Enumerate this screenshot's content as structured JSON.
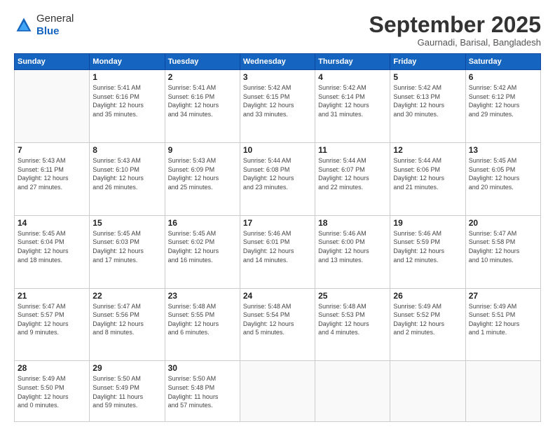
{
  "logo": {
    "general": "General",
    "blue": "Blue"
  },
  "header": {
    "month": "September 2025",
    "location": "Gaurnadi, Barisal, Bangladesh"
  },
  "weekdays": [
    "Sunday",
    "Monday",
    "Tuesday",
    "Wednesday",
    "Thursday",
    "Friday",
    "Saturday"
  ],
  "weeks": [
    [
      {
        "day": "",
        "info": ""
      },
      {
        "day": "1",
        "info": "Sunrise: 5:41 AM\nSunset: 6:16 PM\nDaylight: 12 hours\nand 35 minutes."
      },
      {
        "day": "2",
        "info": "Sunrise: 5:41 AM\nSunset: 6:16 PM\nDaylight: 12 hours\nand 34 minutes."
      },
      {
        "day": "3",
        "info": "Sunrise: 5:42 AM\nSunset: 6:15 PM\nDaylight: 12 hours\nand 33 minutes."
      },
      {
        "day": "4",
        "info": "Sunrise: 5:42 AM\nSunset: 6:14 PM\nDaylight: 12 hours\nand 31 minutes."
      },
      {
        "day": "5",
        "info": "Sunrise: 5:42 AM\nSunset: 6:13 PM\nDaylight: 12 hours\nand 30 minutes."
      },
      {
        "day": "6",
        "info": "Sunrise: 5:42 AM\nSunset: 6:12 PM\nDaylight: 12 hours\nand 29 minutes."
      }
    ],
    [
      {
        "day": "7",
        "info": "Sunrise: 5:43 AM\nSunset: 6:11 PM\nDaylight: 12 hours\nand 27 minutes."
      },
      {
        "day": "8",
        "info": "Sunrise: 5:43 AM\nSunset: 6:10 PM\nDaylight: 12 hours\nand 26 minutes."
      },
      {
        "day": "9",
        "info": "Sunrise: 5:43 AM\nSunset: 6:09 PM\nDaylight: 12 hours\nand 25 minutes."
      },
      {
        "day": "10",
        "info": "Sunrise: 5:44 AM\nSunset: 6:08 PM\nDaylight: 12 hours\nand 23 minutes."
      },
      {
        "day": "11",
        "info": "Sunrise: 5:44 AM\nSunset: 6:07 PM\nDaylight: 12 hours\nand 22 minutes."
      },
      {
        "day": "12",
        "info": "Sunrise: 5:44 AM\nSunset: 6:06 PM\nDaylight: 12 hours\nand 21 minutes."
      },
      {
        "day": "13",
        "info": "Sunrise: 5:45 AM\nSunset: 6:05 PM\nDaylight: 12 hours\nand 20 minutes."
      }
    ],
    [
      {
        "day": "14",
        "info": "Sunrise: 5:45 AM\nSunset: 6:04 PM\nDaylight: 12 hours\nand 18 minutes."
      },
      {
        "day": "15",
        "info": "Sunrise: 5:45 AM\nSunset: 6:03 PM\nDaylight: 12 hours\nand 17 minutes."
      },
      {
        "day": "16",
        "info": "Sunrise: 5:45 AM\nSunset: 6:02 PM\nDaylight: 12 hours\nand 16 minutes."
      },
      {
        "day": "17",
        "info": "Sunrise: 5:46 AM\nSunset: 6:01 PM\nDaylight: 12 hours\nand 14 minutes."
      },
      {
        "day": "18",
        "info": "Sunrise: 5:46 AM\nSunset: 6:00 PM\nDaylight: 12 hours\nand 13 minutes."
      },
      {
        "day": "19",
        "info": "Sunrise: 5:46 AM\nSunset: 5:59 PM\nDaylight: 12 hours\nand 12 minutes."
      },
      {
        "day": "20",
        "info": "Sunrise: 5:47 AM\nSunset: 5:58 PM\nDaylight: 12 hours\nand 10 minutes."
      }
    ],
    [
      {
        "day": "21",
        "info": "Sunrise: 5:47 AM\nSunset: 5:57 PM\nDaylight: 12 hours\nand 9 minutes."
      },
      {
        "day": "22",
        "info": "Sunrise: 5:47 AM\nSunset: 5:56 PM\nDaylight: 12 hours\nand 8 minutes."
      },
      {
        "day": "23",
        "info": "Sunrise: 5:48 AM\nSunset: 5:55 PM\nDaylight: 12 hours\nand 6 minutes."
      },
      {
        "day": "24",
        "info": "Sunrise: 5:48 AM\nSunset: 5:54 PM\nDaylight: 12 hours\nand 5 minutes."
      },
      {
        "day": "25",
        "info": "Sunrise: 5:48 AM\nSunset: 5:53 PM\nDaylight: 12 hours\nand 4 minutes."
      },
      {
        "day": "26",
        "info": "Sunrise: 5:49 AM\nSunset: 5:52 PM\nDaylight: 12 hours\nand 2 minutes."
      },
      {
        "day": "27",
        "info": "Sunrise: 5:49 AM\nSunset: 5:51 PM\nDaylight: 12 hours\nand 1 minute."
      }
    ],
    [
      {
        "day": "28",
        "info": "Sunrise: 5:49 AM\nSunset: 5:50 PM\nDaylight: 12 hours\nand 0 minutes."
      },
      {
        "day": "29",
        "info": "Sunrise: 5:50 AM\nSunset: 5:49 PM\nDaylight: 11 hours\nand 59 minutes."
      },
      {
        "day": "30",
        "info": "Sunrise: 5:50 AM\nSunset: 5:48 PM\nDaylight: 11 hours\nand 57 minutes."
      },
      {
        "day": "",
        "info": ""
      },
      {
        "day": "",
        "info": ""
      },
      {
        "day": "",
        "info": ""
      },
      {
        "day": "",
        "info": ""
      }
    ]
  ]
}
